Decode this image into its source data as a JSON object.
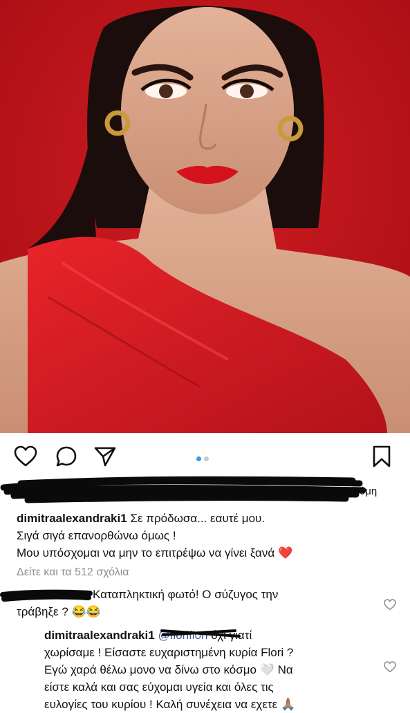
{
  "post": {
    "carousel": {
      "count": 2,
      "active_index": 0
    },
    "icons": [
      "heart-icon",
      "comment-icon",
      "share-icon",
      "bookmark-icon"
    ],
    "likes_tail": "ύμη",
    "caption": {
      "username": "dimitraalexandraki1",
      "line1": "Σε πρόδωσα... εαυτέ μου.",
      "line2": "Σιγά σιγά επανορθώνω όμως !",
      "line3": "Μου υπόσχομαι να μην το επιτρέψω να γίνει ξανά",
      "emoji": "❤️"
    },
    "view_all_comments": "Δείτε και τα 512 σχόλια"
  },
  "comments": [
    {
      "text_line1": "Καταπληκτική φωτό! Ο σύζυγος την",
      "text_line2": "τράβηξε ?",
      "emoji": "😂😂"
    },
    {
      "username": "dimitraalexandraki1",
      "mention": "@floriflori",
      "line1": "όχι γιατί",
      "line2": "χωρίσαμε ! Είσαστε ευχαριστημένη κυρία Flori ?",
      "line3": "Εγώ χαρά θέλω μονο να δίνω στο κόσμο",
      "line3_emoji": "🤍",
      "line3_tail": "Να",
      "line4": "είστε καλά και σας εύχομαι υγεία και όλες τις",
      "line5": "ευλογίες του κυρίου ! Καλή συνέχεια να εχετε",
      "line5_emoji": "🙏🏽"
    }
  ],
  "colors": {
    "background": "#ffffff",
    "photo_red": "#c3161c",
    "dot_active": "#3897f0",
    "muted": "#8e8e8e"
  }
}
